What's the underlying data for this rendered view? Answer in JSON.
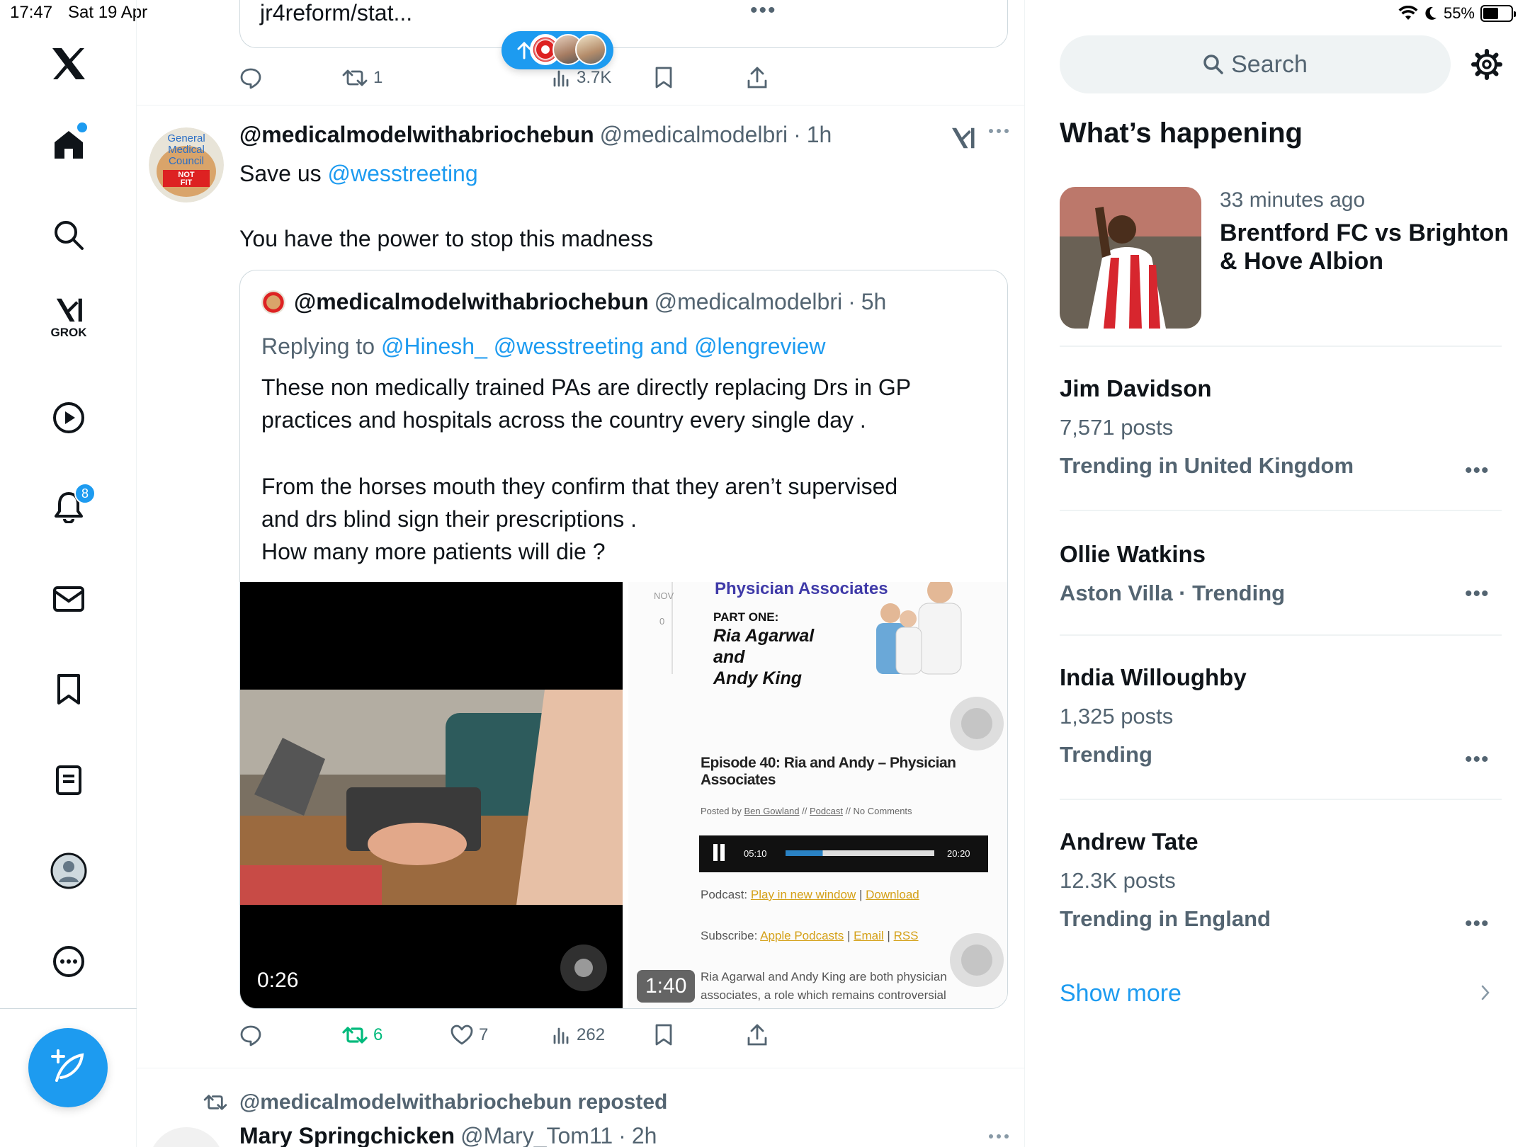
{
  "status_bar": {
    "time": "17:47",
    "date": "Sat 19 Apr",
    "battery": "55%",
    "battery_fraction": 0.55
  },
  "nav": {
    "grok_label": "GROK",
    "notifications_badge": "8",
    "icons": [
      "x-logo-icon",
      "home-icon",
      "search-icon",
      "grok-icon",
      "video-icon",
      "bell-icon",
      "mail-icon",
      "bookmark-icon",
      "lists-icon",
      "profile-icon",
      "more-icon",
      "compose-icon"
    ]
  },
  "prev_tweet": {
    "card_text": "jr4reform/stat...",
    "retweets": "1",
    "views": "3.7K"
  },
  "tweet": {
    "display_name": "@medicalmodelwithabriochebun",
    "handle": "@medicalmodelbri",
    "time": "1h",
    "line1_prefix": "Save us",
    "line1_mention": "@wesstreeting",
    "line2": "You have the power to stop this madness",
    "replies": "",
    "retweets": "6",
    "likes": "7",
    "views": "262",
    "avatar_text": [
      "General",
      "Medical",
      "Council",
      "NOT",
      "FIT"
    ]
  },
  "quote": {
    "display_name": "@medicalmodelwithabriochebun",
    "handle": "@medicalmodelbri",
    "time": "5h",
    "replying_prefix": "Replying to",
    "replying_to": "@Hinesh_ @wesstreeting and @lengreview",
    "lines": [
      "These non medically trained PAs are directly replacing Drs in GP",
      "practices and hospitals across the country every single day .",
      "From the horses mouth they confirm that they aren’t supervised",
      "and drs  blind sign their prescriptions .",
      "How many more patients will die ?"
    ],
    "video_left_duration": "0:26",
    "video_right_duration": "1:40"
  },
  "podcast_card": {
    "header": "Physician Associates",
    "date_label": "NOV",
    "comments_label": "0",
    "part": "PART ONE:",
    "guests": [
      "Ria Agarwal",
      "and",
      "Andy King"
    ],
    "episode": "Episode 40: Ria and Andy – Physician",
    "episode_line2": "Associates",
    "posted_by": "Posted by",
    "author": "Ben Gowland",
    "category": "Podcast",
    "comments": "No Comments",
    "player_elapsed": "05:10",
    "player_total": "20:20",
    "player_progress": 0.25,
    "podcast_label": "Podcast:",
    "play_new": "Play in new window",
    "download": "Download",
    "subscribe_label": "Subscribe:",
    "apple": "Apple Podcasts",
    "email": "Email",
    "rss": "RSS",
    "body_line1": "Ria Agarwal and Andy King are both physician",
    "body_line2": "associates, a role which remains controversial"
  },
  "next_tweet": {
    "repost_label": "@medicalmodelwithabriochebun reposted",
    "display_name": "Mary Springchicken",
    "handle": "@Mary_Tom11",
    "time": "2h"
  },
  "right": {
    "search_placeholder": "Search",
    "section_title": "What’s happening",
    "featured": {
      "time": "33 minutes ago",
      "title_line1": "Brentford FC vs Brighton",
      "title_line2": "& Hove Albion"
    },
    "trends": [
      {
        "name": "Jim Davidson",
        "posts": "7,571 posts",
        "context": "Trending in United Kingdom"
      },
      {
        "name": "Ollie Watkins",
        "posts": "",
        "context": "Aston Villa · Trending"
      },
      {
        "name": "India Willoughby",
        "posts": "1,325 posts",
        "context": "Trending"
      },
      {
        "name": "Andrew Tate",
        "posts": "12.3K posts",
        "context": "Trending in England"
      }
    ],
    "show_more": "Show more"
  },
  "colors": {
    "accent": "#1d9bf0",
    "text": "#0f1419",
    "muted": "#536471",
    "retweet_green": "#00ba7c"
  }
}
